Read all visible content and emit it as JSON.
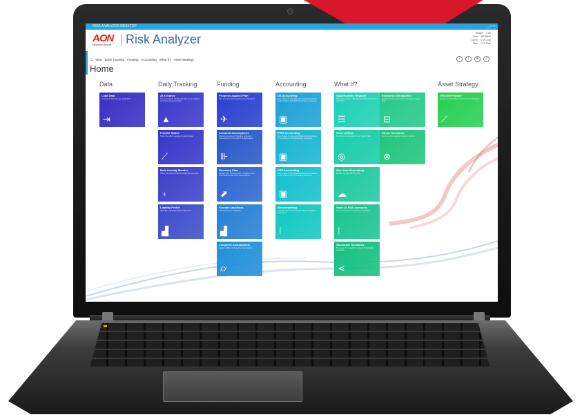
{
  "window": {
    "title": "RISK ANALYZER DESKTOP",
    "controls": "_ □ ×"
  },
  "logo": {
    "brand": "AON",
    "tagline": "Empower Results"
  },
  "app_title": "Risk Analyzer",
  "user_info": [
    {
      "label": "Version",
      "value": "2.00"
    },
    {
      "label": "User",
      "value": "AE38849"
    },
    {
      "label": "Client",
      "value": "XYZ Corp"
    },
    {
      "label": "Plan",
      "value": "XYZ Plan"
    }
  ],
  "nav": [
    "View",
    "Daily Tracking",
    "Funding",
    "Accounting",
    "What If?",
    "Asset Strategy"
  ],
  "right_icons": [
    "?",
    "i",
    "⚙",
    "✓"
  ],
  "page_heading": "Home",
  "columns": [
    {
      "heading": "Data",
      "tiles": [
        {
          "title": "Load Data",
          "desc": "Load your data into the application",
          "icon": "sign-in-icon",
          "glyph": "⇥",
          "color": "#3a2ec4"
        }
      ]
    },
    {
      "heading": "Daily Tracking",
      "tiles": [
        {
          "title": "At a Glance",
          "desc": "See your plan's dashboard with an at-a-glance summary of your position",
          "icon": "mountain-icon",
          "glyph": "▲",
          "color": "#3a38cc"
        },
        {
          "title": "Funded Status",
          "desc": "Track the plan's pension funded status",
          "icon": "trend-line-icon",
          "glyph": "⟋",
          "color": "#3536c8"
        },
        {
          "title": "Bulk Annuity Monitor",
          "desc": "Track the price of bulk annuities for your plan",
          "icon": "funnel-icon",
          "glyph": "⍖",
          "color": "#3d40c8"
        },
        {
          "title": "Liability Profile",
          "desc": "View the projected benefit payments",
          "icon": "bar-chart-icon",
          "glyph": "▟",
          "color": "#3c4ccb"
        }
      ]
    },
    {
      "heading": "Funding",
      "tiles": [
        {
          "title": "Progress Against Plan",
          "desc": "See your progress against your objectives",
          "icon": "airplane-icon",
          "glyph": "✈",
          "color": "#2a3fd0"
        },
        {
          "title": "Actuarial Assumptions",
          "desc": "Examine impact of changing actuarial assumptions on the plan's funded status",
          "icon": "assumptions-icon",
          "glyph": "⊪",
          "color": "#2757c9"
        },
        {
          "title": "Recovery Plan",
          "desc": "Design your recovery plan - lengths, cost, contributions and other assumptions",
          "icon": "recovery-icon",
          "glyph": "⬈",
          "color": "#2e66d0"
        },
        {
          "title": "Funded Cashflows",
          "desc": "Forecast future cashflows",
          "icon": "cashflow-chart-icon",
          "glyph": "▟",
          "color": "#2680d6"
        },
        {
          "title": "Longevity Assumptions",
          "desc": "Explore different longevity assumptions",
          "icon": "walking-icon",
          "glyph": "⌭",
          "color": "#1f8fd9"
        }
      ]
    },
    {
      "heading": "Accounting",
      "tiles": [
        {
          "title": "US Accounting",
          "desc": "See impact of changing actuarial assumptions on the plan's US GAAP accounting measures",
          "icon": "calculator-icon",
          "glyph": "▣",
          "color": "#1ea1d8"
        },
        {
          "title": "IFRS Accounting",
          "desc": "See impact of changing actuarial assumptions on the plan's IFRS accounting measures",
          "icon": "calculator-icon",
          "glyph": "▣",
          "color": "#18b4d3"
        },
        {
          "title": "FRS Accounting",
          "desc": "See impact of changing actuarial assumptions on the plan's FRS accounting measures",
          "icon": "calculator-icon",
          "glyph": "▣",
          "color": "#14bfcd"
        },
        {
          "title": "Benchmarking",
          "desc": "Compare your accounting measures against your peers",
          "icon": "benchmark-icon",
          "glyph": "⁞",
          "color": "#12c8c1"
        }
      ]
    },
    {
      "heading": "What If?",
      "tiles": [
        {
          "title": "Opportunities Register",
          "desc": "See and compare different funding strategies for your plan",
          "icon": "checklist-icon",
          "glyph": "☰",
          "color": "#1ed0b4"
        },
        {
          "title": "Value at Risk",
          "desc": "Identify and understand your plan's risks",
          "icon": "target-icon",
          "glyph": "◎",
          "color": "#18ccaa"
        },
        {
          "title": "One Year Uncertainty",
          "desc": "Model one-year funding risk",
          "icon": "cloud-icon",
          "glyph": "☁",
          "color": "#1ec99e"
        },
        {
          "title": "Value At Risk Scenarios",
          "desc": "See the impact of investment scenarios",
          "icon": "scenarios-icon",
          "glyph": "⁞",
          "color": "#19c490"
        },
        {
          "title": "Stochastic Scenarios",
          "desc": "Test your plan against a range of stochastic scenarios",
          "icon": "share-icon",
          "glyph": "⋖",
          "color": "#16bf80"
        }
      ]
    },
    {
      "heading": "",
      "tiles": [
        {
          "title": "Economic Sensitivities",
          "desc": "Explore impact of economic changes on your plan",
          "icon": "sliders-icon",
          "glyph": "⊟",
          "color": "#24c98a"
        },
        {
          "title": "Stress Scenarios",
          "desc": "Test your plan against stress scenarios",
          "icon": "stress-icon",
          "glyph": "⊗",
          "color": "#20c57c"
        }
      ]
    },
    {
      "heading": "Asset Strategy",
      "tiles": [
        {
          "title": "Efficient Frontier",
          "desc": "Design and test different investment strategies",
          "icon": "frontier-chart-icon",
          "glyph": "⟋",
          "color": "#27cf52"
        }
      ]
    }
  ],
  "colors": {
    "brand_red": "#e0231b",
    "title_blue": "#3d6aa3",
    "titlebar": "#2aa3d8"
  }
}
